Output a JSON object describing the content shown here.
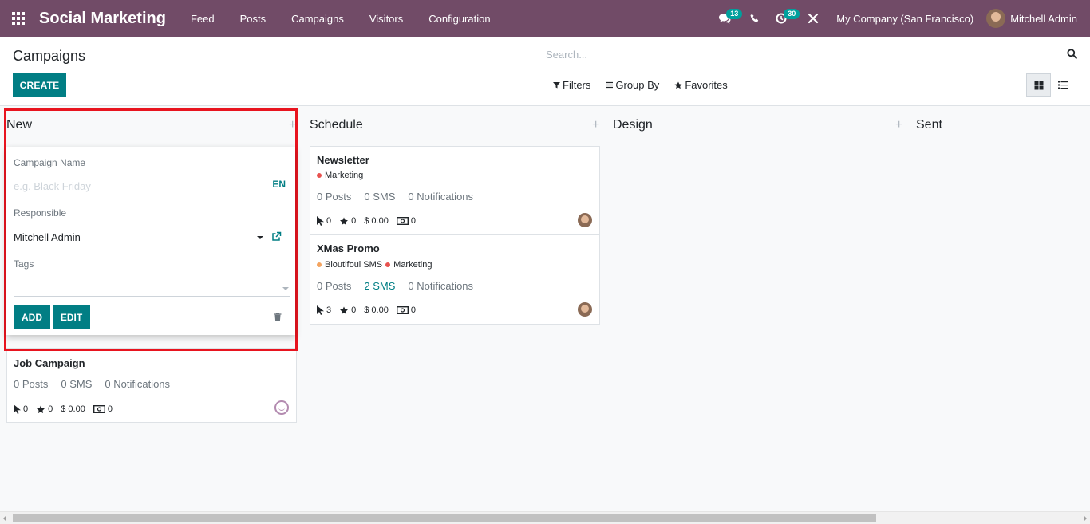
{
  "navbar": {
    "app_title": "Social Marketing",
    "menu": [
      "Feed",
      "Posts",
      "Campaigns",
      "Visitors",
      "Configuration"
    ],
    "chat_badge": "13",
    "activity_badge": "30",
    "company": "My Company (San Francisco)",
    "user": "Mitchell Admin"
  },
  "control_panel": {
    "breadcrumb": "Campaigns",
    "create_label": "CREATE",
    "search_placeholder": "Search...",
    "filters_label": "Filters",
    "group_by_label": "Group By",
    "favorites_label": "Favorites"
  },
  "columns": [
    {
      "title": "New"
    },
    {
      "title": "Schedule"
    },
    {
      "title": "Design"
    },
    {
      "title": "Sent"
    }
  ],
  "quick_create": {
    "campaign_name_label": "Campaign Name",
    "campaign_name_placeholder": "e.g. Black Friday",
    "lang": "EN",
    "responsible_label": "Responsible",
    "responsible_value": "Mitchell Admin",
    "tags_label": "Tags",
    "add_label": "ADD",
    "edit_label": "EDIT"
  },
  "cards": {
    "job_campaign": {
      "title": "Job Campaign",
      "posts": "0 Posts",
      "sms": "0 SMS",
      "notifications": "0 Notifications",
      "clicks": "0",
      "stars": "0",
      "revenue": "$ 0.00",
      "cost": "0"
    },
    "newsletter": {
      "title": "Newsletter",
      "tags": [
        {
          "name": "Marketing",
          "color": "#e8524f"
        }
      ],
      "posts": "0 Posts",
      "sms": "0 SMS",
      "notifications": "0 Notifications",
      "clicks": "0",
      "stars": "0",
      "revenue": "$ 0.00",
      "cost": "0"
    },
    "xmas_promo": {
      "title": "XMas Promo",
      "tags": [
        {
          "name": "Bioutifoul SMS",
          "color": "#f4a460"
        },
        {
          "name": "Marketing",
          "color": "#e8524f"
        }
      ],
      "posts": "0 Posts",
      "sms": "2 SMS",
      "notifications": "0 Notifications",
      "clicks": "3",
      "stars": "0",
      "revenue": "$ 0.00",
      "cost": "0"
    }
  },
  "colors": {
    "navbar": "#714B67",
    "primary": "#017E84",
    "badge": "#00A09D",
    "highlight": "#e8141f"
  }
}
